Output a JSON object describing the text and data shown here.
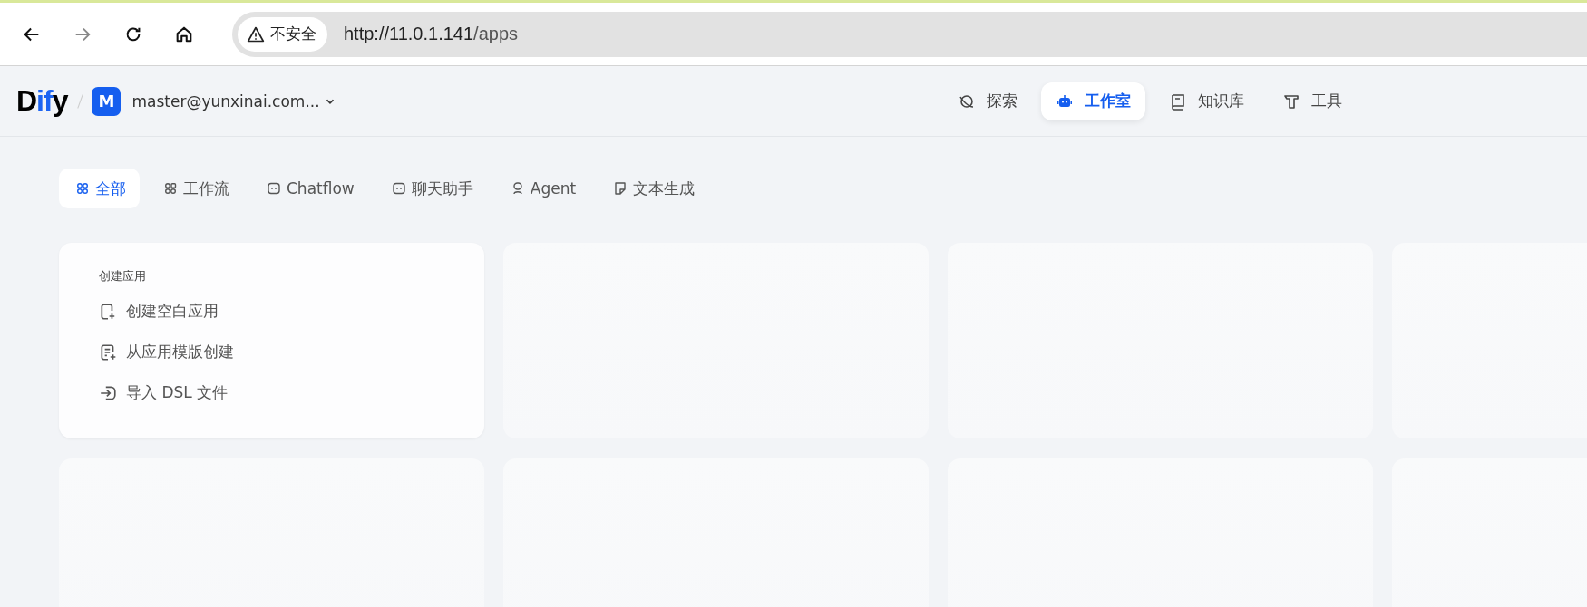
{
  "browser": {
    "security_label": "不安全",
    "url_host": "http://11.0.1.141",
    "url_path": "/apps"
  },
  "header": {
    "logo": "Dify",
    "account_initial": "M",
    "account": "master@yunxinai.com...",
    "nav": [
      {
        "label": "探索",
        "kind": "planet",
        "selected": false
      },
      {
        "label": "工作室",
        "kind": "robot",
        "selected": true
      },
      {
        "label": "知识库",
        "kind": "book",
        "selected": false
      },
      {
        "label": "工具",
        "kind": "hammer",
        "selected": false
      }
    ]
  },
  "filters": [
    {
      "label": "全部",
      "kind": "grid",
      "selected": true
    },
    {
      "label": "工作流",
      "kind": "flow",
      "selected": false
    },
    {
      "label": "Chatflow",
      "kind": "chat",
      "selected": false
    },
    {
      "label": "聊天助手",
      "kind": "chat",
      "selected": false
    },
    {
      "label": "Agent",
      "kind": "agent",
      "selected": false
    },
    {
      "label": "文本生成",
      "kind": "note",
      "selected": false
    }
  ],
  "create_card": {
    "title": "创建应用",
    "actions": [
      {
        "label": "创建空白应用",
        "kind": "blank"
      },
      {
        "label": "从应用模版创建",
        "kind": "template"
      },
      {
        "label": "导入 DSL 文件",
        "kind": "import"
      }
    ]
  }
}
